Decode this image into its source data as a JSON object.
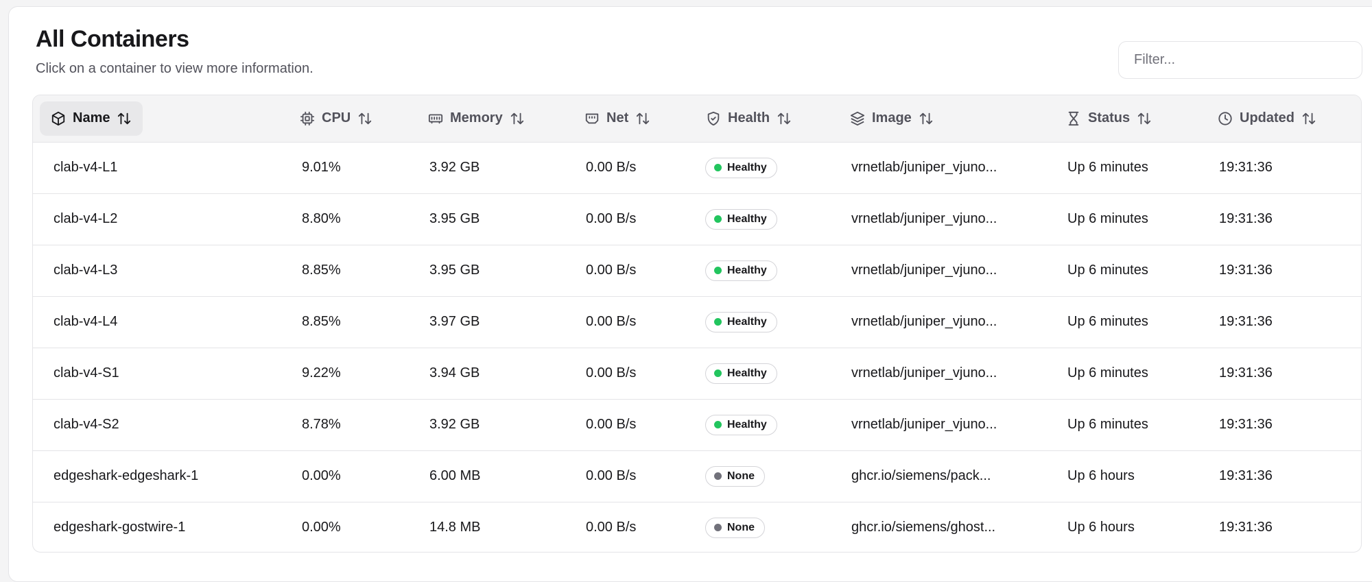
{
  "header": {
    "title": "All Containers",
    "subtitle": "Click on a container to view more information.",
    "filter_placeholder": "Filter..."
  },
  "columns": [
    {
      "label": "Name",
      "icon": "container-box-icon"
    },
    {
      "label": "CPU",
      "icon": "cpu-chip-icon"
    },
    {
      "label": "Memory",
      "icon": "memory-stick-icon"
    },
    {
      "label": "Net",
      "icon": "network-port-icon"
    },
    {
      "label": "Health",
      "icon": "shield-check-icon"
    },
    {
      "label": "Image",
      "icon": "layers-icon"
    },
    {
      "label": "Status",
      "icon": "hourglass-icon"
    },
    {
      "label": "Updated",
      "icon": "clock-icon"
    }
  ],
  "colors": {
    "healthy": "#22c55e",
    "none": "#71717a"
  },
  "rows": [
    {
      "name": "clab-v4-L1",
      "cpu": "9.01%",
      "memory": "3.92 GB",
      "net": "0.00 B/s",
      "health": "Healthy",
      "health_state": "healthy",
      "image": "vrnetlab/juniper_vjuno...",
      "status": "Up 6 minutes",
      "updated": "19:31:36"
    },
    {
      "name": "clab-v4-L2",
      "cpu": "8.80%",
      "memory": "3.95 GB",
      "net": "0.00 B/s",
      "health": "Healthy",
      "health_state": "healthy",
      "image": "vrnetlab/juniper_vjuno...",
      "status": "Up 6 minutes",
      "updated": "19:31:36"
    },
    {
      "name": "clab-v4-L3",
      "cpu": "8.85%",
      "memory": "3.95 GB",
      "net": "0.00 B/s",
      "health": "Healthy",
      "health_state": "healthy",
      "image": "vrnetlab/juniper_vjuno...",
      "status": "Up 6 minutes",
      "updated": "19:31:36"
    },
    {
      "name": "clab-v4-L4",
      "cpu": "8.85%",
      "memory": "3.97 GB",
      "net": "0.00 B/s",
      "health": "Healthy",
      "health_state": "healthy",
      "image": "vrnetlab/juniper_vjuno...",
      "status": "Up 6 minutes",
      "updated": "19:31:36"
    },
    {
      "name": "clab-v4-S1",
      "cpu": "9.22%",
      "memory": "3.94 GB",
      "net": "0.00 B/s",
      "health": "Healthy",
      "health_state": "healthy",
      "image": "vrnetlab/juniper_vjuno...",
      "status": "Up 6 minutes",
      "updated": "19:31:36"
    },
    {
      "name": "clab-v4-S2",
      "cpu": "8.78%",
      "memory": "3.92 GB",
      "net": "0.00 B/s",
      "health": "Healthy",
      "health_state": "healthy",
      "image": "vrnetlab/juniper_vjuno...",
      "status": "Up 6 minutes",
      "updated": "19:31:36"
    },
    {
      "name": "edgeshark-edgeshark-1",
      "cpu": "0.00%",
      "memory": "6.00 MB",
      "net": "0.00 B/s",
      "health": "None",
      "health_state": "none",
      "image": "ghcr.io/siemens/pack...",
      "status": "Up 6 hours",
      "updated": "19:31:36"
    },
    {
      "name": "edgeshark-gostwire-1",
      "cpu": "0.00%",
      "memory": "14.8 MB",
      "net": "0.00 B/s",
      "health": "None",
      "health_state": "none",
      "image": "ghcr.io/siemens/ghost...",
      "status": "Up 6 hours",
      "updated": "19:31:36"
    }
  ]
}
